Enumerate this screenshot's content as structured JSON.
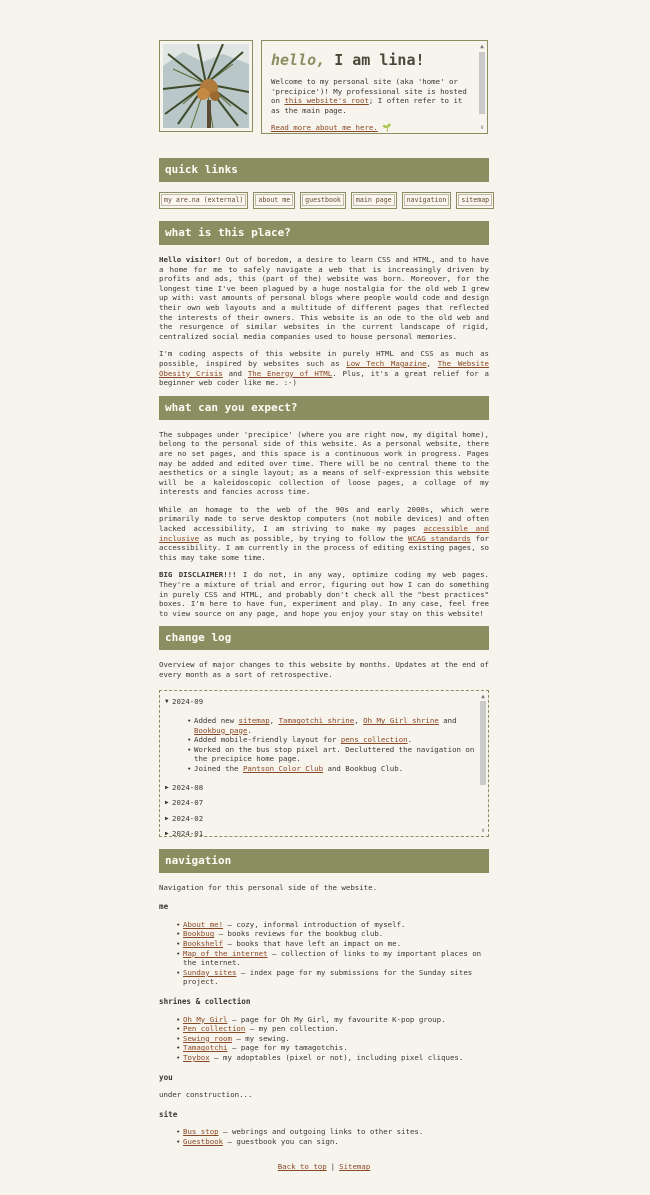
{
  "header": {
    "hello": "hello,",
    "title_rest": " I am lina!",
    "intro_1": "Welcome to my personal site (aka 'home' or 'precipice')! My professional site is hosted on ",
    "intro_link": "this website's root",
    "intro_2": "; I often refer to it as the main page.",
    "read_more": "Read more about me here."
  },
  "quick_links": {
    "title": "quick links",
    "items": [
      "my are.na (external)",
      "about me",
      "guestbook",
      "main page",
      "navigation",
      "sitemap"
    ]
  },
  "what": {
    "title": "what is this place?",
    "p1_bold": "Hello visitor!",
    "p1": " Out of boredom, a desire to learn CSS and HTML, and to have a home for me to safely navigate a web that is increasingly driven by profits and ads, this (part of the) website was born. Moreover, for the longest time I've been plagued by a huge nostalgia for the old web I grew up with: vast amounts of personal blogs where people would code and design their own web layouts and a multitude of different pages that reflected the interests of their owners. This website is an ode to the old web and the resurgence of similar websites in the current landscape of rigid, centralized social media companies used to house personal memories.",
    "p2a": "I'm coding aspects of this website in purely HTML and CSS as much as possible, inspired by websites such as ",
    "p2_l1": "Low Tech Magazine",
    "p2b": ", ",
    "p2_l2": "The Website Obesity Crisis",
    "p2c": " and ",
    "p2_l3": "The Energy of HTML",
    "p2d": ". Plus, it's a great relief for a beginner web coder like me. :-)"
  },
  "expect": {
    "title": "what can you expect?",
    "p1": "The subpages under 'precipice' (where you are right now, my digital home), belong to the personal side of this website. As a personal website, there are no set pages, and this space is a continuous work in progress. Pages may be added and edited over time. There will be no central theme to the aesthetics or a single layout; as a means of self-expression this website will be a kaleidoscopic collection of loose pages, a collage of my interests and fancies across time.",
    "p2a": "While an homage to the web of the 90s and early 2000s, which were primarily made to serve desktop computers (not mobile devices) and often lacked accessibility, I am striving to make my pages ",
    "p2_l1": "accessible and inclusive",
    "p2b": " as much as possible, by trying to follow the ",
    "p2_l2": "WCAG standards",
    "p2c": " for accessibility. I am currently in the process of editing existing pages, so this may take some time.",
    "p3_bold": "BIG DISCLAIMER!!!",
    "p3": " I do not, in any way, optimize coding my web pages. They're a mixture of trial and error, figuring out how I can do something in purely CSS and HTML, and probably don't check all the \"best practices\" boxes. I'm here to have fun, experiment and play. In any case, feel free to view source on any page, and hope you enjoy your stay on this website!"
  },
  "changelog": {
    "title": "change log",
    "intro": "Overview of major changes to this website by months. Updates at the end of every month as a sort of retrospective.",
    "open_month": "2024-09",
    "e1a": "Added new ",
    "e1_l1": "sitemap",
    "e1b": ", ",
    "e1_l2": "Tamagotchi shrine",
    "e1c": ", ",
    "e1_l3": "Oh My Girl shrine",
    "e1d": " and ",
    "e1_l4": "Bookbug page",
    "e1e": ".",
    "e2a": "Added mobile-friendly layout for ",
    "e2_l1": "pens collection",
    "e2b": ".",
    "e3": "Worked on the bus stop pixel art. Decluttered the navigation on the precipice home page.",
    "e4a": "Joined the ",
    "e4_l1": "Pantson Color Club",
    "e4b": " and Bookbug Club.",
    "closed": [
      "2024-08",
      "2024-07",
      "2024-02",
      "2024-01"
    ]
  },
  "navigation": {
    "title": "navigation",
    "intro": "Navigation for this personal side of the website.",
    "groups": [
      {
        "heading": "me",
        "items": [
          {
            "link": "About me!",
            "desc": " – cozy, informal introduction of myself."
          },
          {
            "link": "Bookbug",
            "desc": " – books reviews for the bookbug club."
          },
          {
            "link": "Bookshelf",
            "desc": " – books that have left an impact on me."
          },
          {
            "link": "Map of the internet",
            "desc": " – collection of links to my important places on the internet."
          },
          {
            "link": "Sunday sites",
            "desc": " – index page for my submissions for the Sunday sites project."
          }
        ]
      },
      {
        "heading": "shrines & collection",
        "items": [
          {
            "link": "Oh My Girl",
            "desc": " – page for Oh My Girl, my favourite K-pop group."
          },
          {
            "link": "Pen collection",
            "desc": " – my pen collection."
          },
          {
            "link": "Sewing room",
            "desc": " – my sewing."
          },
          {
            "link": "Tamagotchi",
            "desc": " – page for my tamagotchis."
          },
          {
            "link": "Toybox",
            "desc": " – my adoptables (pixel or not), including pixel cliques."
          }
        ]
      }
    ],
    "you_heading": "you",
    "you_text": "under construction...",
    "site_heading": "site",
    "site_items": [
      {
        "link": "Bus stop",
        "desc": " – webrings and outgoing links to other sites."
      },
      {
        "link": "Guestbook",
        "desc": " – guestbook you can sign."
      }
    ]
  },
  "footer": {
    "back": "Back to top",
    "sep": "|",
    "sitemap": "Sitemap"
  },
  "colors": {
    "accent": "#8a8f62",
    "link": "#8a4a26",
    "background": "#f7f3ed"
  }
}
